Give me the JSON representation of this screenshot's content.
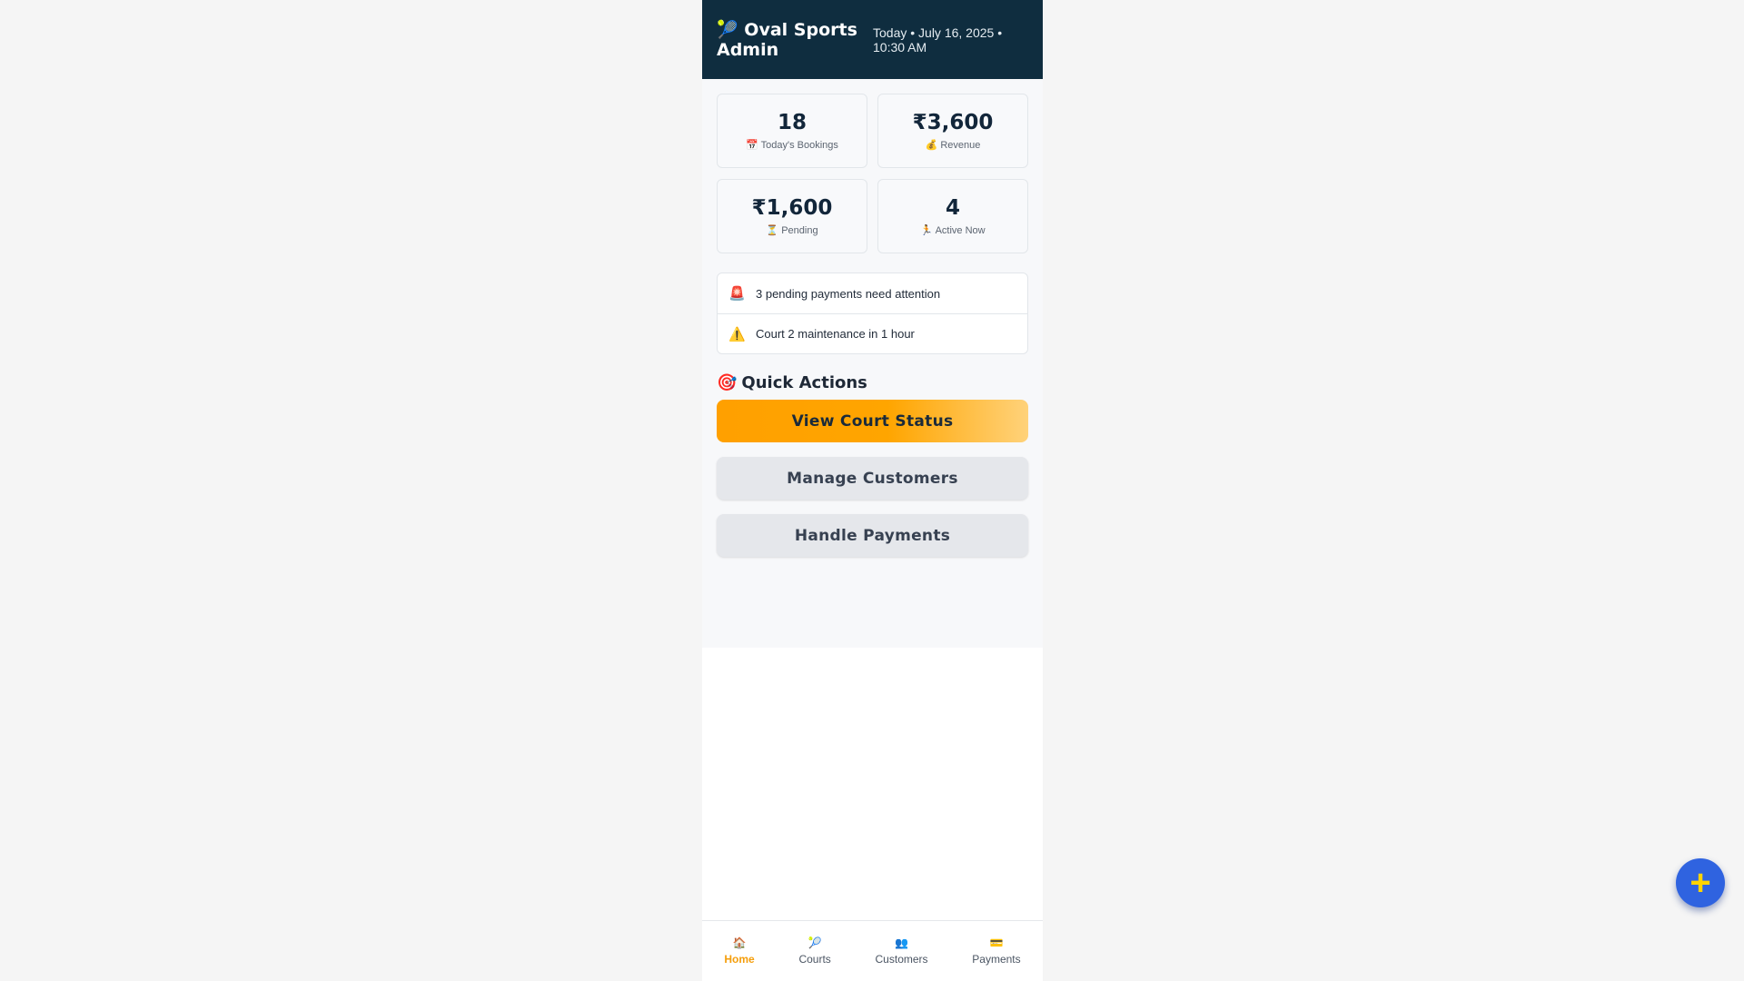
{
  "header": {
    "icon": "🎾",
    "title": "Oval Sports Admin",
    "date": "Today • July 16, 2025 • 10:30 AM"
  },
  "stats": [
    {
      "value": "18",
      "icon": "📅",
      "label": "Today's Bookings"
    },
    {
      "value": "₹3,600",
      "icon": "💰",
      "label": "Revenue"
    },
    {
      "value": "₹1,600",
      "icon": "⏳",
      "label": "Pending"
    },
    {
      "value": "4",
      "icon": "🏃",
      "label": "Active Now"
    }
  ],
  "alerts": [
    {
      "icon": "🚨",
      "text": "3 pending payments need attention"
    },
    {
      "icon": "⚠️",
      "text": "Court 2 maintenance in 1 hour"
    }
  ],
  "quick_actions": {
    "icon": "🎯",
    "title": "Quick Actions",
    "buttons": [
      {
        "label": "View Court Status"
      },
      {
        "label": "Manage Customers"
      },
      {
        "label": "Handle Payments"
      }
    ]
  },
  "nav": [
    {
      "icon": "🏠",
      "label": "Home"
    },
    {
      "icon": "🎾",
      "label": "Courts"
    },
    {
      "icon": "👥",
      "label": "Customers"
    },
    {
      "icon": "💳",
      "label": "Payments"
    }
  ],
  "fab": {
    "symbol": "+"
  },
  "colors": {
    "header_bg": "#0f2d3f",
    "accent": "#ffa000",
    "nav_active": "#f59e0b",
    "fab_bg": "#2f63e0",
    "fab_icon": "#ffd400"
  }
}
